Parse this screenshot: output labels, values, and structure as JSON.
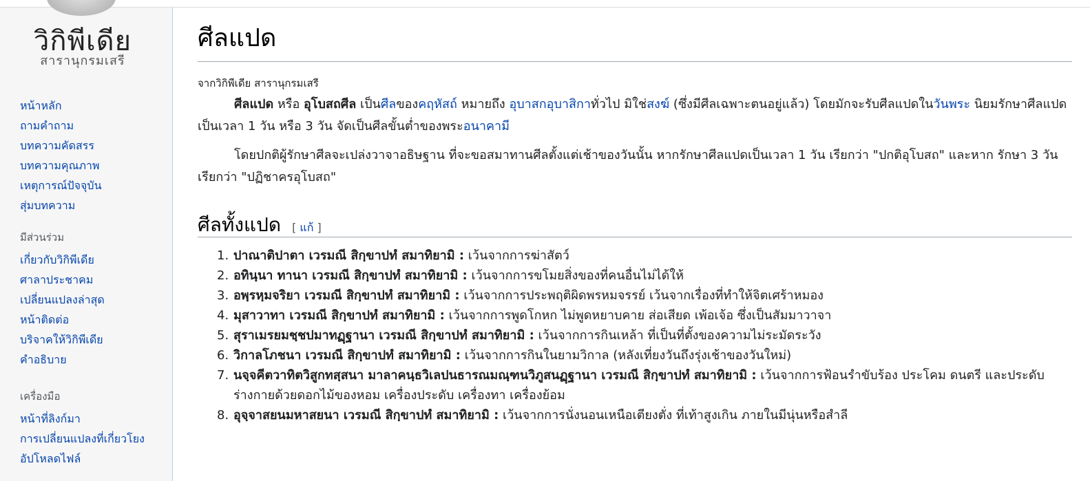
{
  "logo": {
    "name": "วิกิพีเดีย",
    "tagline": "สารานุกรมเสรี"
  },
  "sidebar": {
    "navigation": [
      {
        "label": "หน้าหลัก"
      },
      {
        "label": "ถามคำถาม"
      },
      {
        "label": "บทความคัดสรร"
      },
      {
        "label": "บทความคุณภาพ"
      },
      {
        "label": "เหตุการณ์ปัจจุบัน"
      },
      {
        "label": "สุ่มบทความ"
      }
    ],
    "contribute": {
      "heading": "มีส่วนร่วม",
      "items": [
        {
          "label": "เกี่ยวกับวิกิพีเดีย"
        },
        {
          "label": "ศาลาประชาคม"
        },
        {
          "label": "เปลี่ยนแปลงล่าสุด"
        },
        {
          "label": "หน้าติดต่อ"
        },
        {
          "label": "บริจาคให้วิกิพีเดีย"
        },
        {
          "label": "คำอธิบาย"
        }
      ]
    },
    "tools": {
      "heading": "เครื่องมือ",
      "items": [
        {
          "label": "หน้าที่ลิงก์มา"
        },
        {
          "label": "การเปลี่ยนแปลงที่เกี่ยวโยง"
        },
        {
          "label": "อัปโหลดไฟล์"
        }
      ]
    }
  },
  "article": {
    "title": "ศีลแปด",
    "site_sub": "จากวิกิพีเดีย สารานุกรมเสรี",
    "p1": {
      "bold1": "ศีลแปด",
      "t1": " หรือ ",
      "bold2": "อุโบสถศีล",
      "t2": " เป็น",
      "link1": "ศีล",
      "t3": "ของ",
      "link2": "คฤหัสถ์",
      "t4": " หมายถึง ",
      "link3": "อุบาสกอุบาสิกา",
      "t5": "ทั่วไป มิใช่",
      "link4": "สงฆ์",
      "t6": " (ซึ่งมีศีลเฉพาะตนอยู่แล้ว) โดยมักจะรับศีลแปดใน",
      "link5": "วันพระ",
      "t7": " นิยมรักษาศีลแปดเป็นเวลา 1 วัน หรือ 3 วัน จัดเป็นศีลขั้นต่ำของพระ",
      "link6": "อนาคามี"
    },
    "p2": "โดยปกติผู้รักษาศีลจะเปล่งวาจาอธิษฐาน ที่จะขอสมาทานศีลตั้งแต่เช้าของวันนั้น หากรักษาศีลแปดเป็นเวลา 1 วัน เรียกว่า \"ปกติอุโบสถ\" และหาก รักษา 3 วัน เรียกว่า \"ปฏิชาครอุโบสถ\"",
    "section": {
      "title": "ศีลทั้งแปด",
      "edit_open": "[ ",
      "edit_label": "แก้",
      "edit_close": " ]"
    },
    "precepts": [
      {
        "num": "1.",
        "pali": "ปาณาติปาตา เวรมณี สิกฺขาปทํ สมาทิยามิ :",
        "meaning": " เว้นจากการฆ่าสัตว์"
      },
      {
        "num": "2.",
        "pali": "อทินฺนา ทานา เวรมณี สิกฺขาปทํ สมาทิยามิ :",
        "meaning": " เว้นจากการขโมยสิ่งของที่คนอื่นไม่ได้ให้"
      },
      {
        "num": "3.",
        "pali": "อพฺรหฺมจริยา เวรมณี สิกฺขาปทํ สมาทิยามิ :",
        "meaning": " เว้นจากการประพฤติผิดพรหมจรรย์ เว้นจากเรื่องที่ทำให้จิตเศร้าหมอง"
      },
      {
        "num": "4.",
        "pali": "มุสาวาทา เวรมณี สิกฺขาปทํ สมาทิยามิ :",
        "meaning": " เว้นจากการพูดโกหก ไม่พูดหยาบคาย ส่อเสียด เพ้อเจ้อ ซึ่งเป็นสัมมาวาจา"
      },
      {
        "num": "5.",
        "pali": "สุราเมรยมชฺชปมาทฏฺฐานา เวรมณี สิกฺขาปทํ สมาทิยามิ :",
        "meaning": " เว้นจากการกินเหล้า ที่เป็นที่ตั้งของความไม่ระมัดระวัง"
      },
      {
        "num": "6.",
        "pali": "วิกาลโภชนา เวรมณี สิกฺขาปทํ สมาทิยามิ :",
        "meaning": " เว้นจากการกินในยามวิกาล (หลังเที่ยงวันถึงรุ่งเช้าของวันใหม่)"
      },
      {
        "num": "7.",
        "pali": "นจฺจคีตวาทิตวิสูกทสฺสนา มาลาคนฺธวิเลปนธารณมณฺฑนวิภูสนฏฺฐานา เวรมณี สิกฺขาปทํ สมาทิยามิ :",
        "meaning": " เว้นจากการฟ้อนรำขับร้อง ประโคม ดนตรี และประดับร่างกายด้วยดอกไม้ของหอม เครื่องประดับ เครื่องทา เครื่องย้อม"
      },
      {
        "num": "8.",
        "pali": "อุจฺจาสยนมหาสยนา เวรมณี สิกฺขาปทํ สมาทิยามิ :",
        "meaning": " เว้นจากการนั่งนอนเหนือเตียงตั่ง ที่เท้าสูงเกิน ภายในมีนุ่นหรือสำลี"
      }
    ]
  }
}
